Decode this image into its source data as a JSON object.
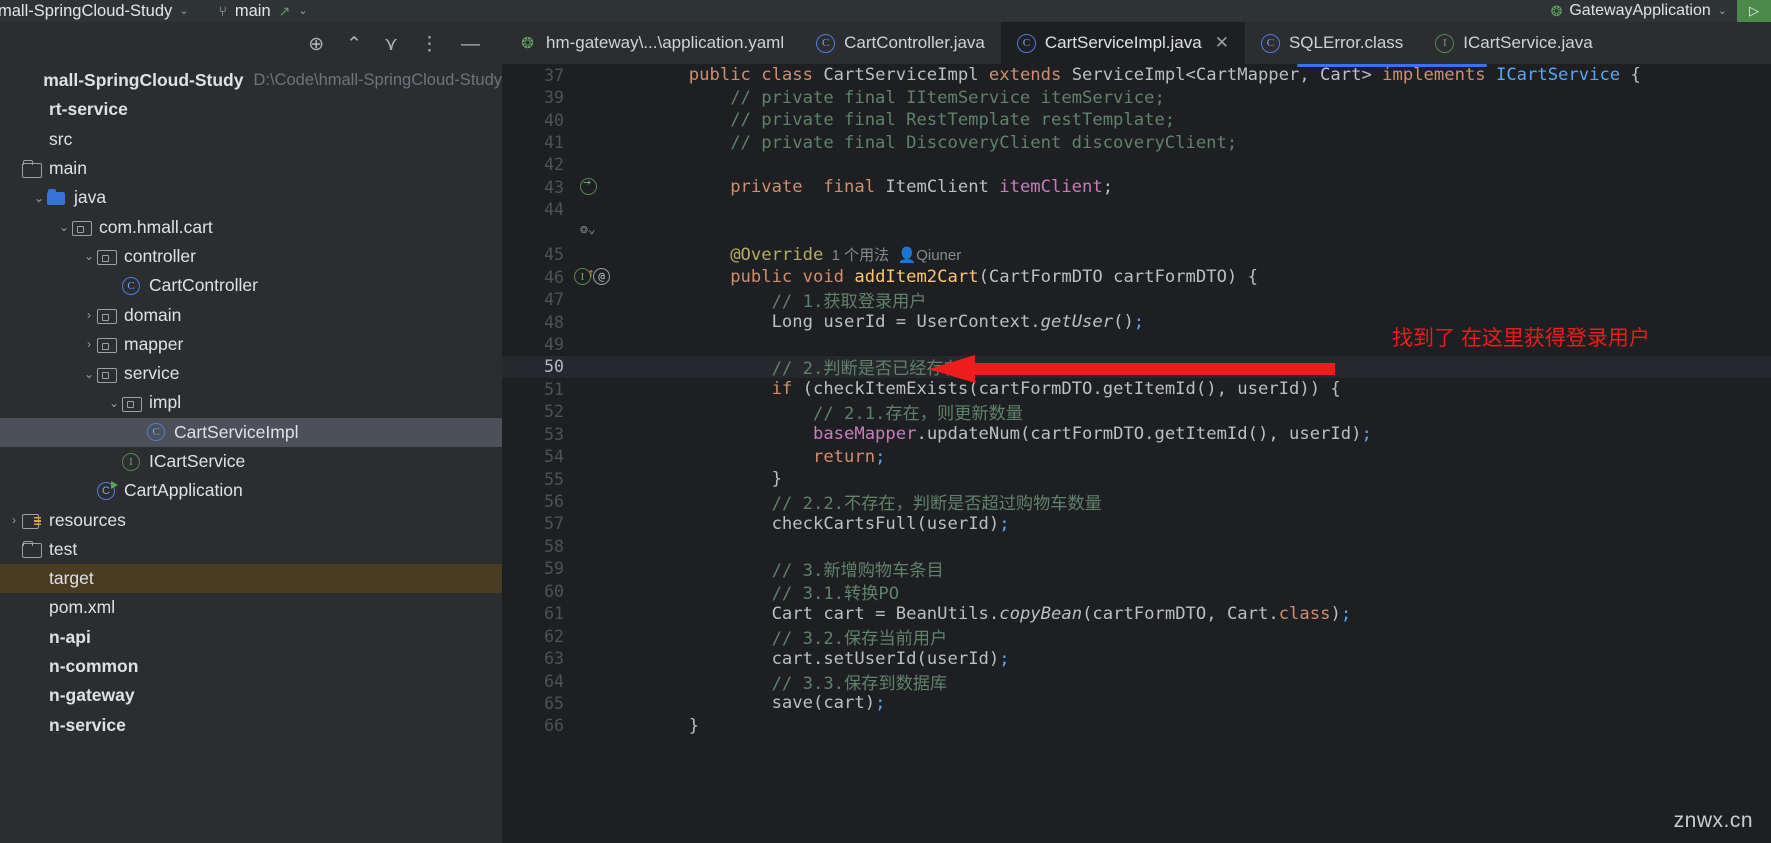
{
  "titlebar": {
    "project_name": "mall-SpringCloud-Study",
    "branch": "main",
    "run_config": "GatewayApplication",
    "chevron": "⌄",
    "branch_icon": "git-branch-icon",
    "arrow_glyph": "↗",
    "run_glyph": "▷"
  },
  "sidebar": {
    "toolbar": {
      "locate": "⊕",
      "expand_collapse": "⌃⌄",
      "collapse_all": "⌄⌃",
      "more": "⋮",
      "hide": "—"
    },
    "items": [
      {
        "label": "mall-SpringCloud-Study",
        "path": "D:\\Code\\hmall-SpringCloud-Study",
        "indent": 0,
        "twisty": "",
        "icon": "none",
        "bold": true,
        "state": "normal"
      },
      {
        "label": "rt-service",
        "path": "",
        "indent": 0,
        "twisty": "",
        "icon": "none",
        "bold": true,
        "state": "normal"
      },
      {
        "label": "src",
        "path": "",
        "indent": 0,
        "twisty": "",
        "icon": "none",
        "bold": false,
        "state": "normal"
      },
      {
        "label": "main",
        "path": "",
        "indent": 0,
        "twisty": "",
        "icon": "folder",
        "bold": false,
        "state": "normal"
      },
      {
        "label": "java",
        "path": "",
        "indent": 1,
        "twisty": "⌄",
        "icon": "folder-blue",
        "bold": false,
        "state": "normal"
      },
      {
        "label": "com.hmall.cart",
        "path": "",
        "indent": 2,
        "twisty": "⌄",
        "icon": "pkg",
        "bold": false,
        "state": "normal"
      },
      {
        "label": "controller",
        "path": "",
        "indent": 3,
        "twisty": "⌄",
        "icon": "pkg",
        "bold": false,
        "state": "normal"
      },
      {
        "label": "CartController",
        "path": "",
        "indent": 4,
        "twisty": "",
        "icon": "class",
        "bold": false,
        "state": "normal"
      },
      {
        "label": "domain",
        "path": "",
        "indent": 3,
        "twisty": "›",
        "icon": "pkg",
        "bold": false,
        "state": "normal"
      },
      {
        "label": "mapper",
        "path": "",
        "indent": 3,
        "twisty": "›",
        "icon": "pkg",
        "bold": false,
        "state": "normal"
      },
      {
        "label": "service",
        "path": "",
        "indent": 3,
        "twisty": "⌄",
        "icon": "pkg",
        "bold": false,
        "state": "normal"
      },
      {
        "label": "impl",
        "path": "",
        "indent": 4,
        "twisty": "⌄",
        "icon": "pkg",
        "bold": false,
        "state": "normal"
      },
      {
        "label": "CartServiceImpl",
        "path": "",
        "indent": 5,
        "twisty": "",
        "icon": "class",
        "bold": false,
        "state": "selected"
      },
      {
        "label": "ICartService",
        "path": "",
        "indent": 4,
        "twisty": "",
        "icon": "interface",
        "bold": false,
        "state": "normal"
      },
      {
        "label": "CartApplication",
        "path": "",
        "indent": 3,
        "twisty": "",
        "icon": "runnable-class",
        "bold": false,
        "state": "normal"
      },
      {
        "label": "resources",
        "path": "",
        "indent": 0,
        "twisty": "›",
        "icon": "resources",
        "bold": false,
        "state": "normal"
      },
      {
        "label": "test",
        "path": "",
        "indent": 0,
        "twisty": "",
        "icon": "folder",
        "bold": false,
        "state": "normal"
      },
      {
        "label": "target",
        "path": "",
        "indent": 0,
        "twisty": "",
        "icon": "none",
        "bold": false,
        "state": "target"
      },
      {
        "label": "pom.xml",
        "path": "",
        "indent": 0,
        "twisty": "",
        "icon": "none",
        "bold": false,
        "state": "normal"
      },
      {
        "label": "n-api",
        "path": "",
        "indent": 0,
        "twisty": "",
        "icon": "none",
        "bold": true,
        "state": "normal"
      },
      {
        "label": "n-common",
        "path": "",
        "indent": 0,
        "twisty": "",
        "icon": "none",
        "bold": true,
        "state": "normal"
      },
      {
        "label": "n-gateway",
        "path": "",
        "indent": 0,
        "twisty": "",
        "icon": "none",
        "bold": true,
        "state": "normal"
      },
      {
        "label": "n-service",
        "path": "",
        "indent": 0,
        "twisty": "",
        "icon": "none",
        "bold": true,
        "state": "normal"
      }
    ]
  },
  "editor": {
    "tabs": [
      {
        "label": "hm-gateway\\...\\application.yaml",
        "icon": "yaml-icon",
        "active": false,
        "closable": false
      },
      {
        "label": "CartController.java",
        "icon": "class-icon",
        "active": false,
        "closable": false
      },
      {
        "label": "CartServiceImpl.java",
        "icon": "class-icon",
        "active": true,
        "closable": true,
        "close_glyph": "✕"
      },
      {
        "label": "SQLError.class",
        "icon": "class-icon",
        "active": false,
        "closable": false
      },
      {
        "label": "ICartService.java",
        "icon": "interface-icon",
        "active": false,
        "closable": false
      }
    ],
    "code_vision": {
      "usages": "1 个用法",
      "author": "Qiuner",
      "author_icon": "person-icon"
    },
    "lines": [
      {
        "no": "37",
        "indent": 0
      },
      {
        "no": "39",
        "indent": 0
      },
      {
        "no": "40",
        "indent": 0
      },
      {
        "no": "41",
        "indent": 0
      },
      {
        "no": "42",
        "indent": 0
      },
      {
        "no": "43",
        "indent": 0
      },
      {
        "no": "44",
        "indent": 0
      },
      {
        "no": "",
        "indent": 0
      },
      {
        "no": "45",
        "indent": 0
      },
      {
        "no": "46",
        "indent": 0
      },
      {
        "no": "47",
        "indent": 0
      },
      {
        "no": "48",
        "indent": 0
      },
      {
        "no": "49",
        "indent": 0
      },
      {
        "no": "50",
        "indent": 0
      },
      {
        "no": "51",
        "indent": 0
      },
      {
        "no": "52",
        "indent": 0
      },
      {
        "no": "53",
        "indent": 0
      },
      {
        "no": "54",
        "indent": 0
      },
      {
        "no": "55",
        "indent": 0
      },
      {
        "no": "56",
        "indent": 0
      },
      {
        "no": "57",
        "indent": 0
      },
      {
        "no": "58",
        "indent": 0
      },
      {
        "no": "59",
        "indent": 0
      },
      {
        "no": "60",
        "indent": 0
      },
      {
        "no": "61",
        "indent": 0
      },
      {
        "no": "62",
        "indent": 0
      },
      {
        "no": "63",
        "indent": 0
      },
      {
        "no": "64",
        "indent": 0
      },
      {
        "no": "65",
        "indent": 0
      },
      {
        "no": "66",
        "indent": 0
      }
    ],
    "code_text": {
      "l37": "public class CartServiceImpl extends ServiceImpl<CartMapper, Cart> implements ICartService {",
      "l39": "// private final IItemService itemService;",
      "l40": "// private final RestTemplate restTemplate;",
      "l41": "// private final DiscoveryClient discoveryClient;",
      "l43": "private  final ItemClient itemClient;",
      "l45": "@Override",
      "l46": "public void addItem2Cart(CartFormDTO cartFormDTO) {",
      "l47": "// 1.获取登录用户",
      "l48": "Long userId = UserContext.getUser();",
      "l50": "// 2.判断是否已经存在",
      "l51": "if (checkItemExists(cartFormDTO.getItemId(), userId)) {",
      "l52": "// 2.1.存在，则更新数量",
      "l53": "baseMapper.updateNum(cartFormDTO.getItemId(), userId);",
      "l54": "return;",
      "l55": "}",
      "l56": "// 2.2.不存在，判断是否超过购物车数量",
      "l57": "checkCartsFull(userId);",
      "l59": "// 3.新增购物车条目",
      "l60": "// 3.1.转换PO",
      "l61": "Cart cart = BeanUtils.copyBean(cartFormDTO, Cart.class);",
      "l62": "// 3.2.保存当前用户",
      "l63": "cart.setUserId(userId);",
      "l64": "// 3.3.保存到数据库",
      "l65": "save(cart);",
      "l66": "}"
    },
    "annotation": {
      "text": "找到了 在这里获得登录用户",
      "color": "#f0191c"
    },
    "watermark": "znwx.cn"
  }
}
